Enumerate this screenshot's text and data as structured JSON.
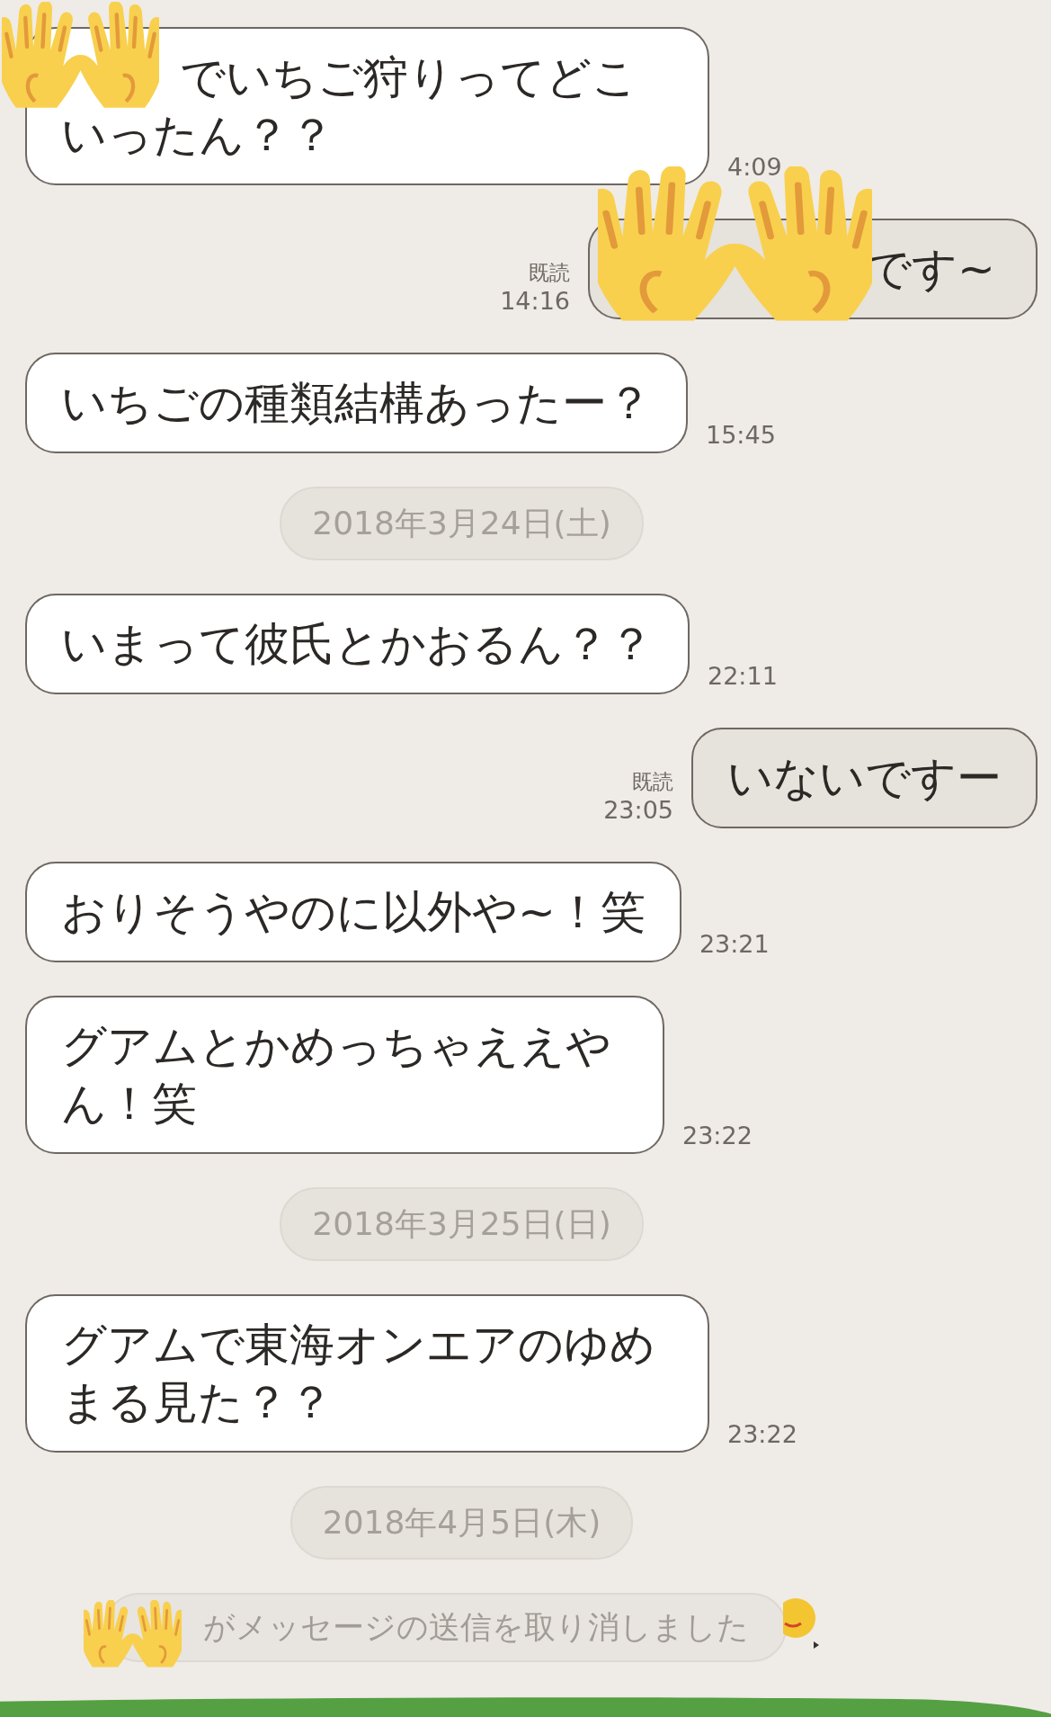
{
  "messages": [
    {
      "kind": "incoming",
      "text": "でいちご狩りってどこいったん？？",
      "time": "4:09"
    },
    {
      "kind": "outgoing",
      "read": "既読",
      "text": "です~",
      "time": "14:16"
    },
    {
      "kind": "incoming",
      "text": "いちごの種類結構あったー？",
      "time": "15:45"
    },
    {
      "kind": "date",
      "text": "2018年3月24日(土)"
    },
    {
      "kind": "incoming",
      "text": "いまって彼氏とかおるん？？",
      "time": "22:11"
    },
    {
      "kind": "outgoing",
      "read": "既読",
      "text": "いないですー",
      "time": "23:05"
    },
    {
      "kind": "incoming",
      "text": "おりそうやのに以外や~！笑",
      "time": "23:21"
    },
    {
      "kind": "incoming",
      "text": "グアムとかめっちゃええやん！笑",
      "time": "23:22"
    },
    {
      "kind": "date",
      "text": "2018年3月25日(日)"
    },
    {
      "kind": "incoming",
      "text": "グアムで東海オンエアのゆめまる見た？？",
      "time": "23:22"
    },
    {
      "kind": "date",
      "text": "2018年4月5日(木)"
    },
    {
      "kind": "notice",
      "text": "がメッセージの送信を取り消しました"
    }
  ]
}
